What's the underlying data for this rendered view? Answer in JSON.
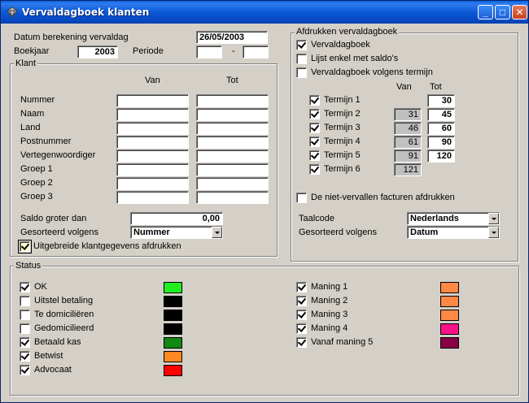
{
  "window": {
    "title": "Vervaldagboek klanten",
    "icon": "diamond-app-icon",
    "controls": {
      "minimize": "_",
      "maximize": "□",
      "close": "✕"
    }
  },
  "header": {
    "datum_label": "Datum berekening vervaldag",
    "datum_value": "26/05/2003",
    "boekjaar_label": "Boekjaar",
    "boekjaar_value": "2003",
    "periode_label": "Periode",
    "periode_from": "",
    "periode_sep": "-",
    "periode_to": ""
  },
  "klant": {
    "title": "Klant",
    "col_van": "Van",
    "col_tot": "Tot",
    "rows": [
      {
        "label": "Nummer",
        "van": "",
        "tot": ""
      },
      {
        "label": "Naam",
        "van": "",
        "tot": ""
      },
      {
        "label": "Land",
        "van": "",
        "tot": ""
      },
      {
        "label": "Postnummer",
        "van": "",
        "tot": ""
      },
      {
        "label": "Vertegenwoordiger",
        "van": "",
        "tot": ""
      },
      {
        "label": "Groep 1",
        "van": "",
        "tot": ""
      },
      {
        "label": "Groep 2",
        "van": "",
        "tot": ""
      },
      {
        "label": "Groep 3",
        "van": "",
        "tot": ""
      }
    ],
    "saldo_label": "Saldo groter dan",
    "saldo_value": "0,00",
    "sort_label": "Gesorteerd volgens",
    "sort_value": "Nummer",
    "uitgebreid_label": "Uitgebreide klantgegevens afdrukken",
    "uitgebreid_checked": true
  },
  "afdrukken": {
    "title": "Afdrukken vervaldagboek",
    "options": [
      {
        "label": "Vervaldagboek",
        "checked": true
      },
      {
        "label": "Lijst enkel met saldo's",
        "checked": false
      },
      {
        "label": "Vervaldagboek volgens termijn",
        "checked": false
      }
    ],
    "col_van": "Van",
    "col_tot": "Tot",
    "termijnen": [
      {
        "label": "Termijn 1",
        "checked": true,
        "van": "",
        "tot": "30"
      },
      {
        "label": "Termijn 2",
        "checked": true,
        "van": "31",
        "tot": "45"
      },
      {
        "label": "Termijn 3",
        "checked": true,
        "van": "46",
        "tot": "60"
      },
      {
        "label": "Termijn 4",
        "checked": true,
        "van": "61",
        "tot": "90"
      },
      {
        "label": "Termijn 5",
        "checked": true,
        "van": "91",
        "tot": "120"
      },
      {
        "label": "Termijn 6",
        "checked": true,
        "van": "121",
        "tot": ""
      }
    ],
    "niet_vervallen_label": "De niet-vervallen facturen afdrukken",
    "niet_vervallen_checked": false,
    "taalcode_label": "Taalcode",
    "taalcode_value": "Nederlands",
    "sort_label": "Gesorteerd volgens",
    "sort_value": "Datum"
  },
  "status": {
    "title": "Status",
    "left": [
      {
        "label": "OK",
        "checked": true,
        "color": "#22ee22"
      },
      {
        "label": "Uitstel betaling",
        "checked": false,
        "color": "#000000"
      },
      {
        "label": "Te domiciliëren",
        "checked": false,
        "color": "#000000"
      },
      {
        "label": "Gedomicilieerd",
        "checked": false,
        "color": "#000000"
      },
      {
        "label": "Betaald kas",
        "checked": true,
        "color": "#118811"
      },
      {
        "label": "Betwist",
        "checked": true,
        "color": "#ff8822"
      },
      {
        "label": "Advocaat",
        "checked": true,
        "color": "#ff0000"
      }
    ],
    "right": [
      {
        "label": "Maning 1",
        "checked": true,
        "color": "#ff8844"
      },
      {
        "label": "Maning 2",
        "checked": true,
        "color": "#ff8844"
      },
      {
        "label": "Maning 3",
        "checked": true,
        "color": "#ff8844"
      },
      {
        "label": "Maning 4",
        "checked": true,
        "color": "#ff1188"
      },
      {
        "label": "Vanaf maning 5",
        "checked": true,
        "color": "#880044"
      }
    ]
  }
}
